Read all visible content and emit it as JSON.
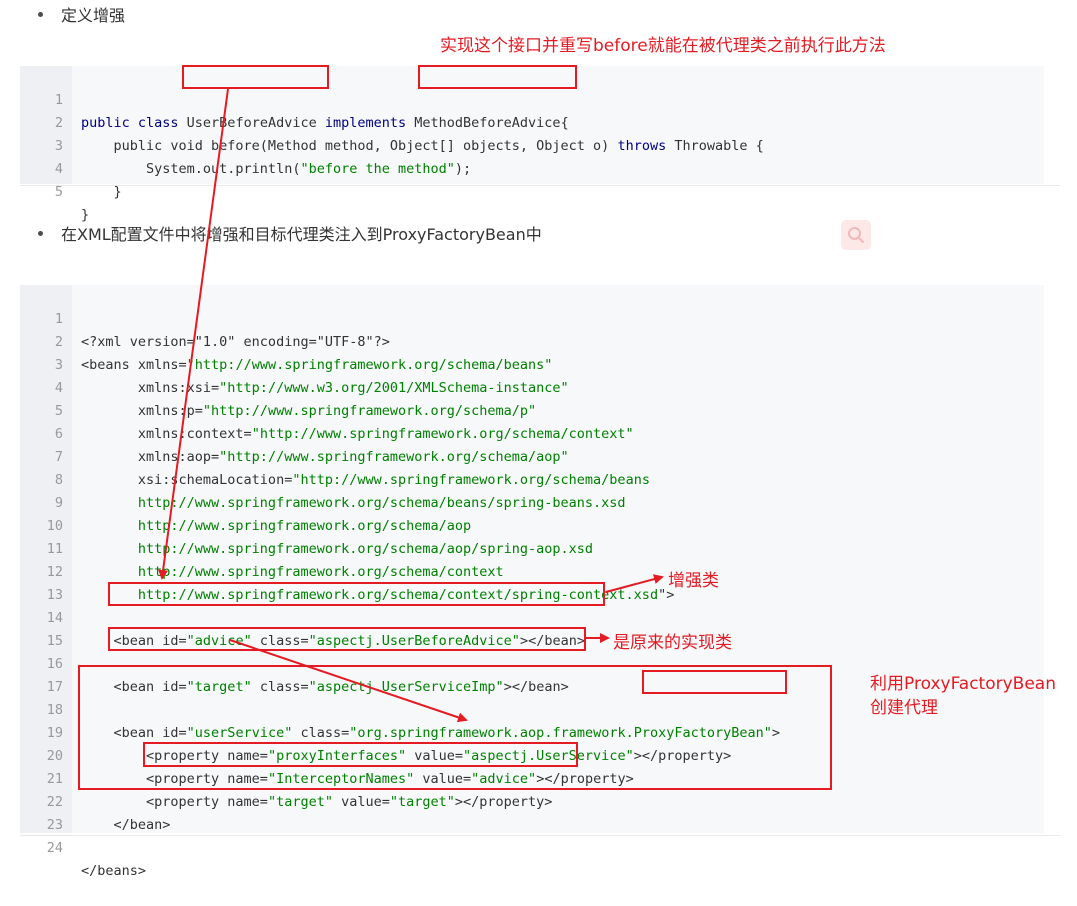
{
  "bullets": {
    "first": "定义增强",
    "second": "在XML配置文件中将增强和目标代理类注入到ProxyFactoryBean中"
  },
  "annotations": {
    "top": "实现这个接口并重写before就能在被代理类之前执行此方法",
    "enhance_class": "增强类",
    "original_impl": "是原来的实现类",
    "proxy_line1": "利用ProxyFactoryBean",
    "proxy_line2": "创建代理"
  },
  "java_code": {
    "line_numbers": [
      "1",
      "2",
      "3",
      "4",
      "5"
    ],
    "l1": {
      "a": "public class ",
      "b": "UserBeforeAdvice",
      "c": " implements ",
      "d": "MethodBeforeAdvice",
      "e": "{"
    },
    "l2": {
      "a": "    public void before(Method method, Object[] objects, Object o) ",
      "b": "throws",
      "c": " Throwable {"
    },
    "l3": {
      "a": "        System.out.println(",
      "b": "\"before the method\"",
      "c": ");"
    },
    "l4": "    }",
    "l5": "}"
  },
  "xml_code": {
    "line_numbers": [
      "1",
      "2",
      "3",
      "4",
      "5",
      "6",
      "7",
      "8",
      "9",
      "10",
      "11",
      "12",
      "13",
      "14",
      "15",
      "16",
      "17",
      "18",
      "19",
      "20",
      "21",
      "22",
      "23",
      "24"
    ],
    "l1": "<?xml version=\"1.0\" encoding=\"UTF-8\"?>",
    "l2": {
      "a": "<beans xmlns=",
      "b": "\"http://www.springframework.org/schema/beans\""
    },
    "l3": {
      "a": "       xmlns:xsi=",
      "b": "\"http://www.w3.org/2001/XMLSchema-instance\""
    },
    "l4": {
      "a": "       xmlns:p=",
      "b": "\"http://www.springframework.org/schema/p\""
    },
    "l5": {
      "a": "       xmlns:context=",
      "b": "\"http://www.springframework.org/schema/context\""
    },
    "l6": {
      "a": "       xmlns:aop=",
      "b": "\"http://www.springframework.org/schema/aop\""
    },
    "l7": {
      "a": "       xsi:schemaLocation=",
      "b": "\"http://www.springframework.org/schema/beans"
    },
    "l8": "       http://www.springframework.org/schema/beans/spring-beans.xsd",
    "l9": "       http://www.springframework.org/schema/aop",
    "l10": "       http://www.springframework.org/schema/aop/spring-aop.xsd",
    "l11": "       http://www.springframework.org/schema/context",
    "l12": {
      "a": "       http://www.springframework.org/schema/context/spring-context.xsd",
      "b": "\">"
    },
    "l14": {
      "a": "    <bean id=",
      "b": "\"advice\"",
      "c": " class=",
      "d": "\"aspectj.UserBeforeAdvice\"",
      "e": "></bean>"
    },
    "l16": {
      "a": "    <bean id=",
      "b": "\"target\"",
      "c": " class=",
      "d": "\"aspectj.UserServiceImp\"",
      "e": "></bean>"
    },
    "l18": {
      "a": "    <bean id=",
      "b": "\"userService\"",
      "c": " class=",
      "d": "\"org.springframework.aop.framework.",
      "e": "ProxyFactoryBean",
      "f": "\"",
      "g": ">"
    },
    "l19": {
      "a": "        <property name=",
      "b": "\"proxyInterfaces\"",
      "c": " value=",
      "d": "\"aspectj.UserService\"",
      "e": "></property>"
    },
    "l20": {
      "a": "        <property name=",
      "b": "\"InterceptorNames\"",
      "c": " value=",
      "d": "\"advice\"",
      "e": "></property>"
    },
    "l21": {
      "a": "        <property name=",
      "b": "\"target\"",
      "c": " value=",
      "d": "\"target\"",
      "e": "></property>"
    },
    "l22": "    </bean>",
    "l24": "</beans>"
  },
  "colors": {
    "annotation_red": "#e41b23",
    "code_bg": "#f6f8fa",
    "keyword": "#000080",
    "string": "#008000"
  }
}
